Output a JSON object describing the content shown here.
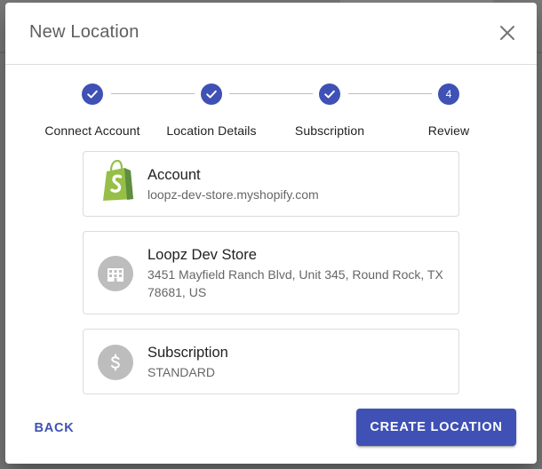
{
  "dialog": {
    "title": "New Location"
  },
  "stepper": {
    "steps": [
      {
        "label": "Connect Account",
        "state": "completed"
      },
      {
        "label": "Location Details",
        "state": "completed"
      },
      {
        "label": "Subscription",
        "state": "completed"
      },
      {
        "label": "Review",
        "state": "active",
        "number": "4"
      }
    ]
  },
  "cards": {
    "account": {
      "title": "Account",
      "subtitle": "loopz-dev-store.myshopify.com",
      "icon": "shopify-logo"
    },
    "location": {
      "title": "Loopz Dev Store",
      "address_line1": "3451 Mayfield Ranch Blvd, Unit 345, Round Rock, TX",
      "address_line2": "78681, US",
      "icon": "building-icon"
    },
    "subscription": {
      "title": "Subscription",
      "subtitle": "STANDARD",
      "icon": "dollar-icon"
    }
  },
  "actions": {
    "back_label": "BACK",
    "create_label": "CREATE LOCATION"
  },
  "colors": {
    "primary": "#3f51b5",
    "shopify_green": "#95bf47",
    "avatar_grey": "#bdbdbd"
  }
}
